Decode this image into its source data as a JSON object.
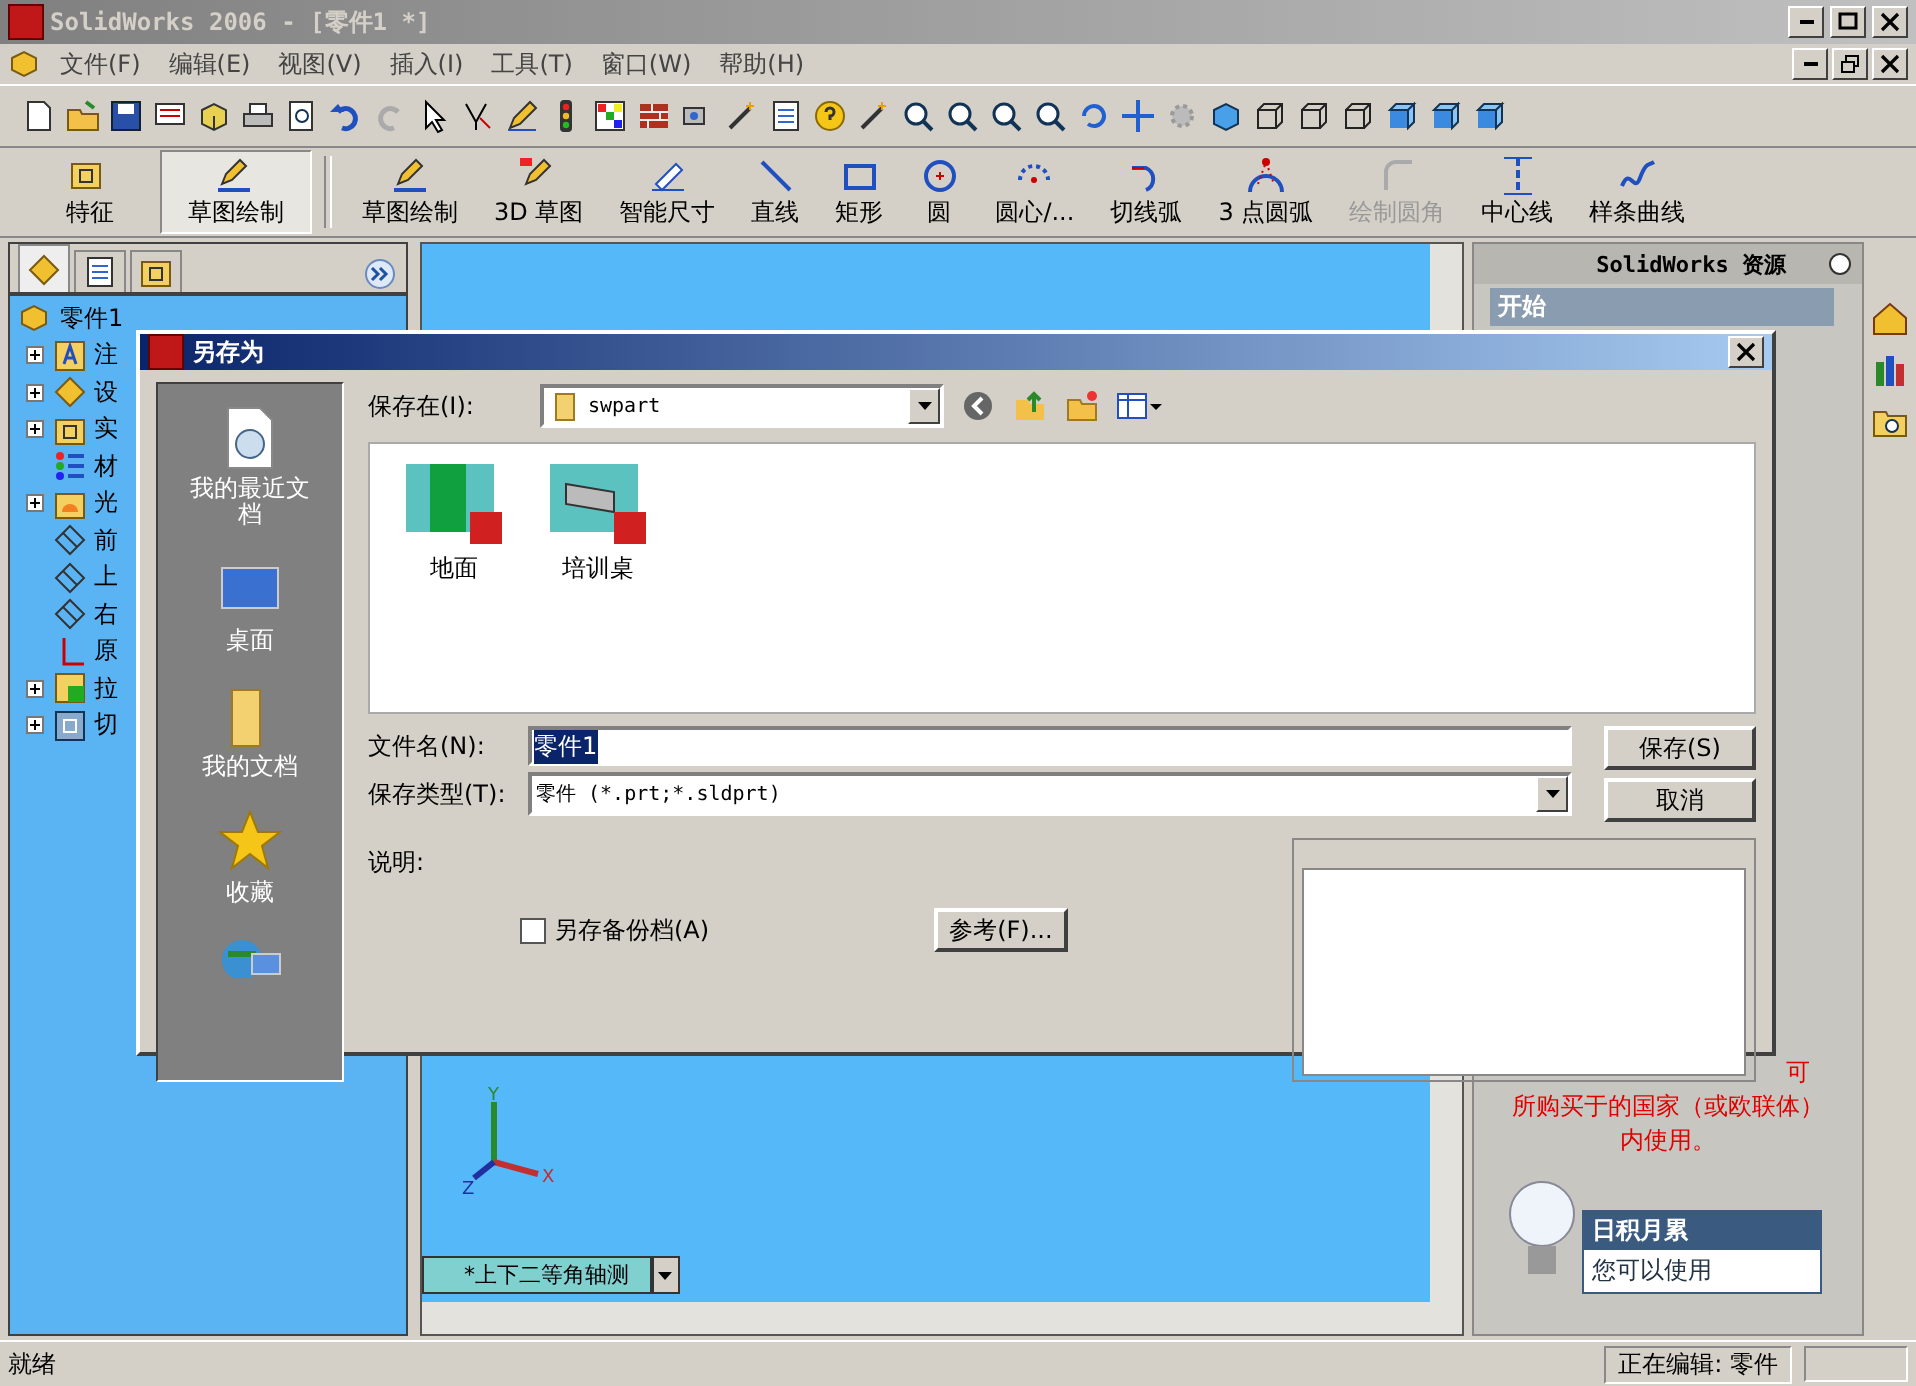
{
  "window": {
    "title": "SolidWorks 2006 - [零件1 *]"
  },
  "menu": [
    "文件(F)",
    "编辑(E)",
    "视图(V)",
    "插入(I)",
    "工具(T)",
    "窗口(W)",
    "帮助(H)"
  ],
  "command_manager": {
    "groups": [
      {
        "label": "特征",
        "selected": false
      },
      {
        "label": "草图绘制",
        "selected": true
      }
    ],
    "tools": [
      {
        "label": "草图绘制",
        "disabled": false
      },
      {
        "label": "3D 草图",
        "disabled": false
      },
      {
        "label": "智能尺寸",
        "disabled": false
      },
      {
        "label": "直线",
        "disabled": false
      },
      {
        "label": "矩形",
        "disabled": false
      },
      {
        "label": "圆",
        "disabled": false
      },
      {
        "label": "圆心/...",
        "disabled": false
      },
      {
        "label": "切线弧",
        "disabled": false
      },
      {
        "label": "3 点圆弧",
        "disabled": false
      },
      {
        "label": "绘制圆角",
        "disabled": true
      },
      {
        "label": "中心线",
        "disabled": false
      },
      {
        "label": "样条曲线",
        "disabled": false
      }
    ]
  },
  "feature_manager": {
    "tabs": [
      {
        "selected": true
      },
      {
        "selected": false
      },
      {
        "selected": false
      }
    ],
    "root": "零件1",
    "items": [
      {
        "label": "注",
        "kind": "group"
      },
      {
        "label": "设",
        "kind": "group"
      },
      {
        "label": "实",
        "kind": "group"
      },
      {
        "label": "材",
        "kind": "leaf"
      },
      {
        "label": "光",
        "kind": "group"
      },
      {
        "label": "前",
        "kind": "leaf"
      },
      {
        "label": "上",
        "kind": "leaf"
      },
      {
        "label": "右",
        "kind": "leaf"
      },
      {
        "label": "原",
        "kind": "leaf"
      },
      {
        "label": "拉",
        "kind": "group"
      },
      {
        "label": "切",
        "kind": "group"
      }
    ]
  },
  "viewport": {
    "view_name": "*上下二等角轴测",
    "axes": [
      "X",
      "Y",
      "Z"
    ]
  },
  "task_pane": {
    "title": "SolidWorks 资源",
    "section": "开始",
    "notice_lines": [
      "可",
      "所购买于的国家（或欧联体）",
      "内使用。"
    ],
    "tip_title": "日积月累",
    "tip_text": "您可以使用"
  },
  "dialog": {
    "title": "另存为",
    "places": [
      "我的最近文档",
      "桌面",
      "我的文档",
      "收藏"
    ],
    "save_in_label": "保存在(I):",
    "save_in": "swpart",
    "files": [
      "地面",
      "培训桌"
    ],
    "file_name_label": "文件名(N):",
    "file_name": "零件1",
    "type_label": "保存类型(T):",
    "type": "零件 (*.prt;*.sldprt)",
    "save_button": "保存(S)",
    "cancel_button": "取消",
    "description_label": "说明:",
    "backup": {
      "label": "另存备份档(A)",
      "checked": false
    },
    "references_button": "参考(F)..."
  },
  "status_bar": {
    "left": "就绪",
    "right": "正在编辑: 零件"
  }
}
